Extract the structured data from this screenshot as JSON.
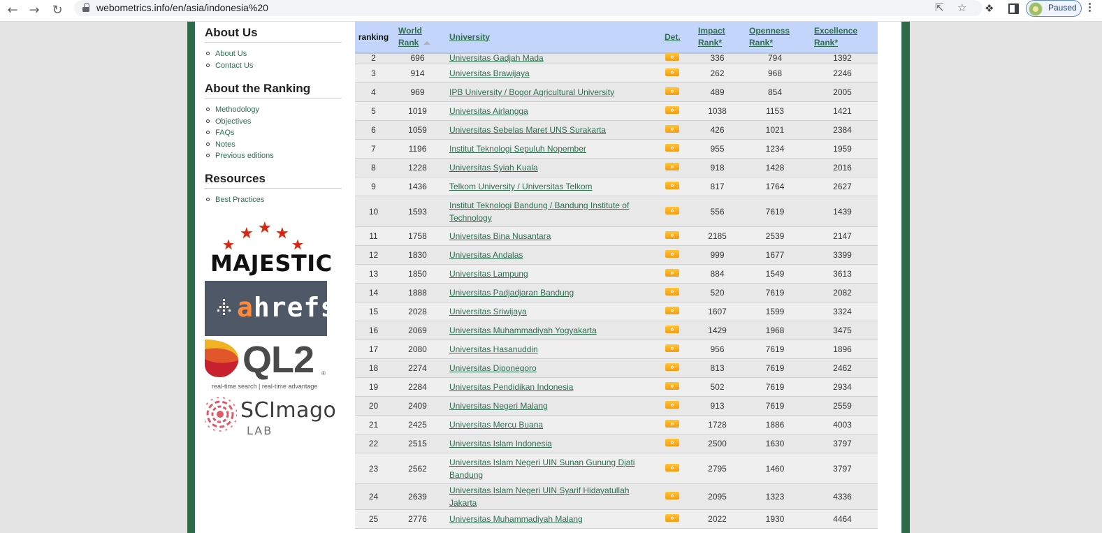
{
  "browser": {
    "url": "webometrics.info/en/asia/indonesia%20",
    "profile_label": "Paused"
  },
  "sidebar": {
    "about_us": {
      "title": "About Us",
      "links": [
        "About Us",
        "Contact Us"
      ]
    },
    "about_ranking": {
      "title": "About the Ranking",
      "links": [
        "Methodology",
        "Objectives",
        "FAQs",
        "Notes",
        "Previous editions"
      ]
    },
    "resources": {
      "title": "Resources",
      "links": [
        "Best Practices"
      ]
    },
    "logos": {
      "majestic": "MAJESTIC",
      "ahrefs_a": "a",
      "ahrefs_rest": "hrefs",
      "ql2": "QL2",
      "ql2_tagline": "real-time search | real-time advantage",
      "scimago": "SCImago",
      "scimago_sub": "LAB"
    }
  },
  "table": {
    "headers": {
      "ranking": "ranking",
      "world_rank_1": "World",
      "world_rank_2": "Rank",
      "university": "University",
      "det": "Det.",
      "impact_1": "Impact",
      "impact_2": "Rank*",
      "openness_1": "Openness",
      "openness_2": "Rank*",
      "excellence_1": "Excellence",
      "excellence_2": "Rank*"
    },
    "det_button": "»",
    "rows": [
      {
        "ranking": "2",
        "world": "696",
        "university": "Universitas Gadjah Mada",
        "impact": "336",
        "openness": "794",
        "excellence": "1392"
      },
      {
        "ranking": "3",
        "world": "914",
        "university": "Universitas Brawijaya",
        "impact": "262",
        "openness": "968",
        "excellence": "2246"
      },
      {
        "ranking": "4",
        "world": "969",
        "university": "IPB University / Bogor Agricultural University",
        "impact": "489",
        "openness": "854",
        "excellence": "2005"
      },
      {
        "ranking": "5",
        "world": "1019",
        "university": "Universitas Airlangga",
        "impact": "1038",
        "openness": "1153",
        "excellence": "1421"
      },
      {
        "ranking": "6",
        "world": "1059",
        "university": "Universitas Sebelas Maret UNS Surakarta",
        "impact": "426",
        "openness": "1021",
        "excellence": "2384"
      },
      {
        "ranking": "7",
        "world": "1196",
        "university": "Institut Teknologi Sepuluh Nopember",
        "impact": "955",
        "openness": "1234",
        "excellence": "1959"
      },
      {
        "ranking": "8",
        "world": "1228",
        "university": "Universitas Syiah Kuala",
        "impact": "918",
        "openness": "1428",
        "excellence": "2016"
      },
      {
        "ranking": "9",
        "world": "1436",
        "university": "Telkom University / Universitas Telkom",
        "impact": "817",
        "openness": "1764",
        "excellence": "2627"
      },
      {
        "ranking": "10",
        "world": "1593",
        "university": "Institut Teknologi Bandung / Bandung Institute of Technology",
        "impact": "556",
        "openness": "7619",
        "excellence": "1439"
      },
      {
        "ranking": "11",
        "world": "1758",
        "university": "Universitas Bina Nusantara",
        "impact": "2185",
        "openness": "2539",
        "excellence": "2147"
      },
      {
        "ranking": "12",
        "world": "1830",
        "university": "Universitas Andalas",
        "impact": "999",
        "openness": "1677",
        "excellence": "3399"
      },
      {
        "ranking": "13",
        "world": "1850",
        "university": "Universitas Lampung",
        "impact": "884",
        "openness": "1549",
        "excellence": "3613"
      },
      {
        "ranking": "14",
        "world": "1888",
        "university": "Universitas Padjadjaran Bandung",
        "impact": "520",
        "openness": "7619",
        "excellence": "2082"
      },
      {
        "ranking": "15",
        "world": "2028",
        "university": "Universitas Sriwijaya",
        "impact": "1607",
        "openness": "1599",
        "excellence": "3324"
      },
      {
        "ranking": "16",
        "world": "2069",
        "university": "Universitas Muhammadiyah Yogyakarta",
        "impact": "1429",
        "openness": "1968",
        "excellence": "3475"
      },
      {
        "ranking": "17",
        "world": "2080",
        "university": "Universitas Hasanuddin",
        "impact": "956",
        "openness": "7619",
        "excellence": "1896"
      },
      {
        "ranking": "18",
        "world": "2274",
        "university": "Universitas Diponegoro",
        "impact": "813",
        "openness": "7619",
        "excellence": "2462"
      },
      {
        "ranking": "19",
        "world": "2284",
        "university": "Universitas Pendidikan Indonesia",
        "impact": "502",
        "openness": "7619",
        "excellence": "2934"
      },
      {
        "ranking": "20",
        "world": "2409",
        "university": "Universitas Negeri Malang",
        "impact": "913",
        "openness": "7619",
        "excellence": "2559"
      },
      {
        "ranking": "21",
        "world": "2425",
        "university": "Universitas Mercu Buana",
        "impact": "1728",
        "openness": "1886",
        "excellence": "4003"
      },
      {
        "ranking": "22",
        "world": "2515",
        "university": "Universitas Islam Indonesia",
        "impact": "2500",
        "openness": "1630",
        "excellence": "3797"
      },
      {
        "ranking": "23",
        "world": "2562",
        "university": "Universitas Islam Negeri UIN Sunan Gunung Djati Bandung",
        "impact": "2795",
        "openness": "1460",
        "excellence": "3797"
      },
      {
        "ranking": "24",
        "world": "2639",
        "university": "Universitas Islam Negeri UIN Syarif Hidayatullah Jakarta",
        "impact": "2095",
        "openness": "1323",
        "excellence": "4336"
      },
      {
        "ranking": "25",
        "world": "2776",
        "university": "Universitas Muhammadiyah Malang",
        "impact": "2022",
        "openness": "1930",
        "excellence": "4464"
      }
    ]
  }
}
